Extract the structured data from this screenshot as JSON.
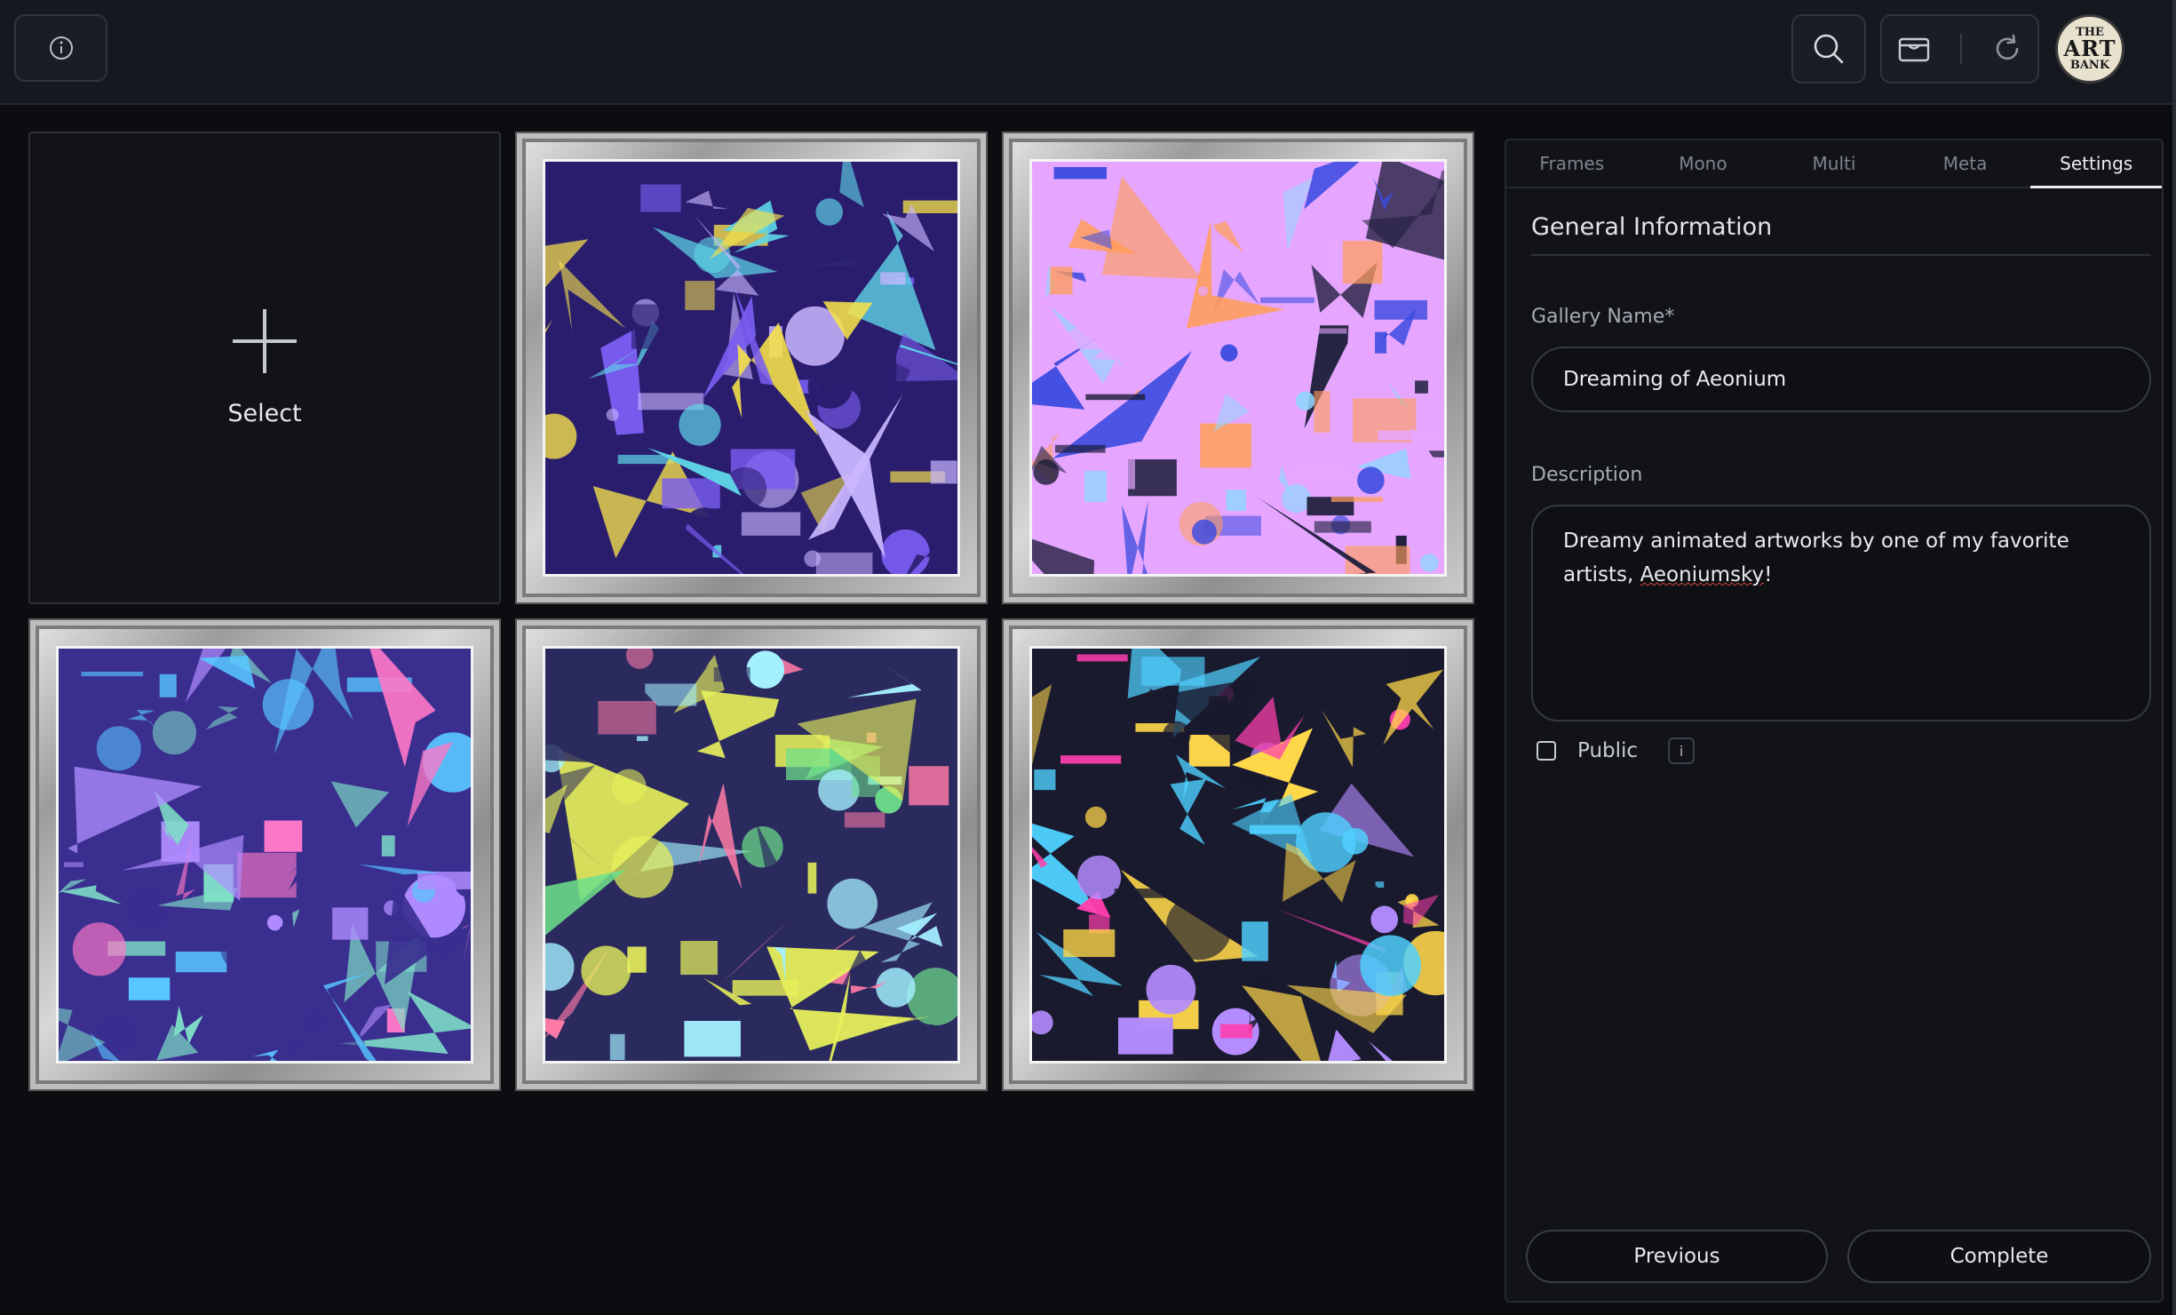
{
  "topbar": {
    "info_icon": "info-circle-icon",
    "search_icon": "search-icon",
    "wallet_icon": "wallet-icon",
    "refresh_icon": "refresh-icon",
    "logo": {
      "line1": "THE",
      "line2": "ART",
      "line3": "BANK"
    }
  },
  "grid": {
    "select_label": "Select",
    "artworks": [
      {
        "palette": [
          "#7a5cf0",
          "#c9b6ff",
          "#2a1d6e",
          "#f5e14a",
          "#5fd6e8"
        ]
      },
      {
        "palette": [
          "#3b4be0",
          "#8fd8ff",
          "#e6a6ff",
          "#1c1d3a",
          "#ff9e5a"
        ]
      },
      {
        "palette": [
          "#58c7ff",
          "#b08cff",
          "#3a2f8f",
          "#7ee0c8",
          "#ff78c8"
        ]
      },
      {
        "palette": [
          "#6de08a",
          "#a4f0ff",
          "#2a2a5e",
          "#e7f05a",
          "#ff7aa6"
        ]
      },
      {
        "palette": [
          "#ff3fae",
          "#4fd0ff",
          "#1a1a2e",
          "#ffd84a",
          "#b48cff"
        ]
      }
    ]
  },
  "panel": {
    "tabs": [
      "Frames",
      "Mono",
      "Multi",
      "Meta",
      "Settings"
    ],
    "active_tab": "Settings",
    "section_title": "General Information",
    "gallery_name_label": "Gallery Name*",
    "gallery_name_value": "Dreaming of Aeonium",
    "description_label": "Description",
    "description_text": "Dreamy animated artworks by one of my favorite artists,",
    "description_word": "Aeoniumsky",
    "description_end": "!",
    "public_label": "Public",
    "public_checked": false,
    "public_info": "i",
    "previous_label": "Previous",
    "complete_label": "Complete"
  }
}
